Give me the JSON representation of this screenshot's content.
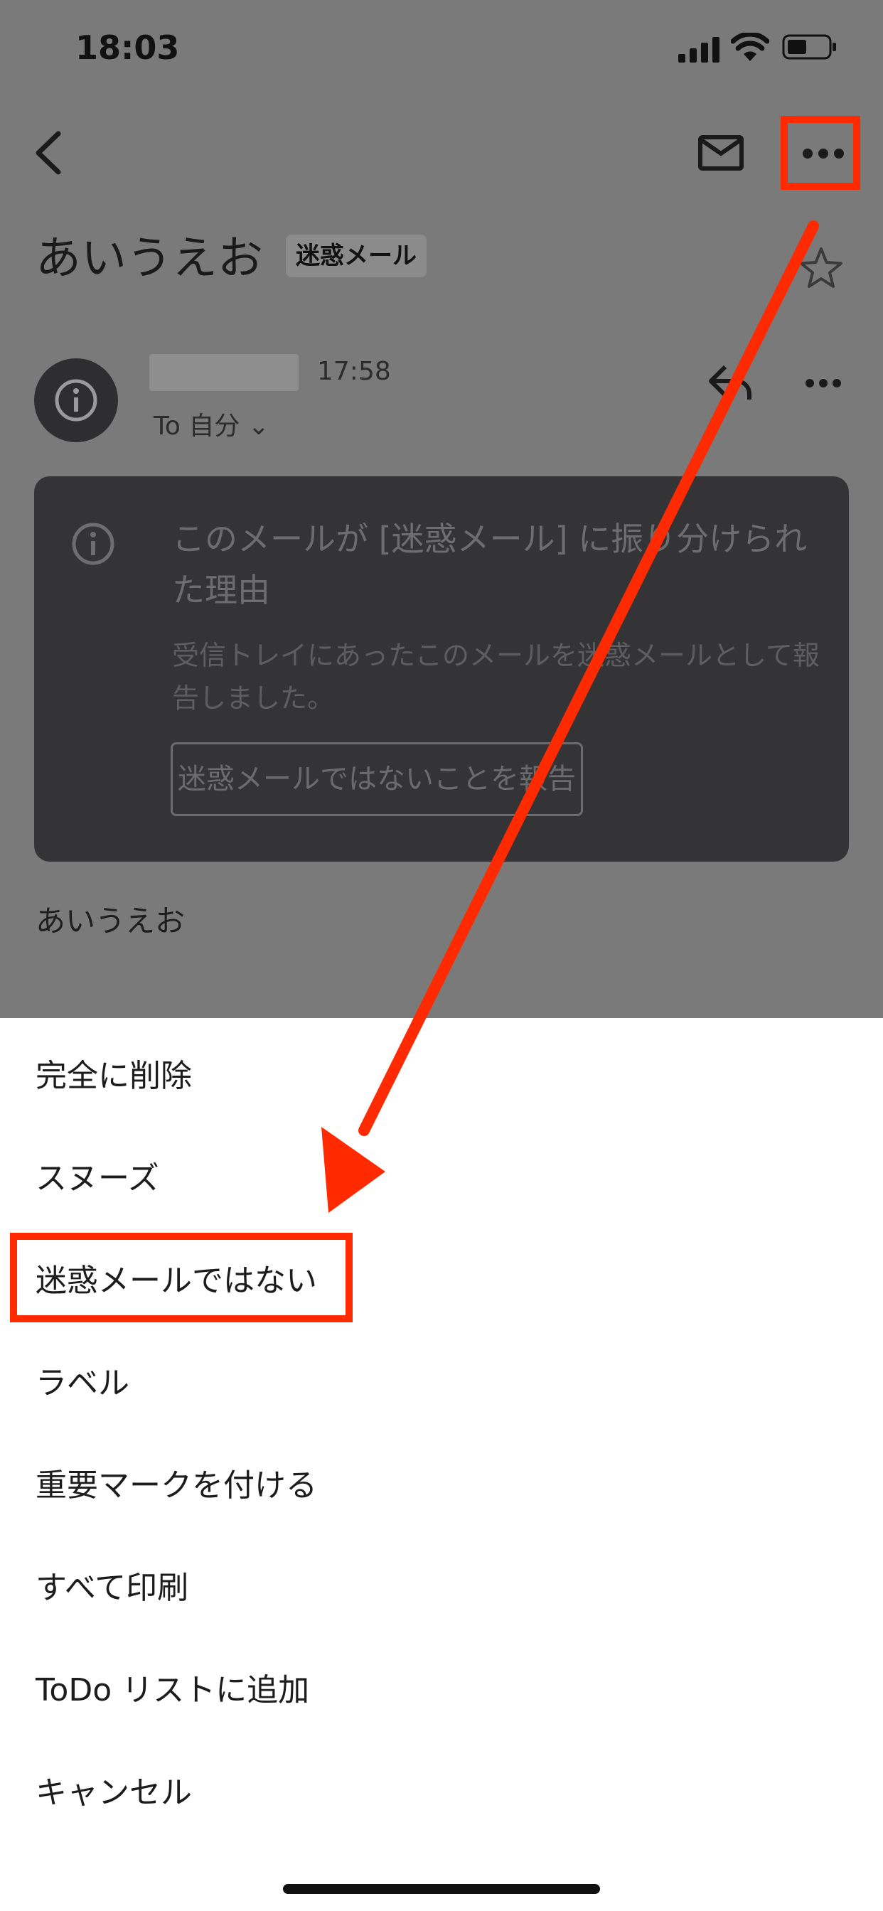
{
  "status_bar": {
    "time": "18:03"
  },
  "email": {
    "subject": "あいうえお",
    "badge": "迷惑メール",
    "sender_time": "17:58",
    "to_line": "To 自分 ⌄",
    "notice": {
      "title": "このメールが [迷惑メール] に振り分けられた理由",
      "body": "受信トレイにあったこのメールを迷惑メールとして報告しました。",
      "button": "迷惑メールではないことを報告"
    },
    "body_text": "あいうえお"
  },
  "action_sheet": {
    "items": [
      "完全に削除",
      "スヌーズ",
      "迷惑メールではない",
      "ラベル",
      "重要マークを付ける",
      "すべて印刷",
      "ToDo リストに追加",
      "キャンセル"
    ]
  },
  "colors": {
    "highlight": "#ff2a00",
    "dim_overlay": "#7a7a7a",
    "notice_card": "#343437"
  }
}
